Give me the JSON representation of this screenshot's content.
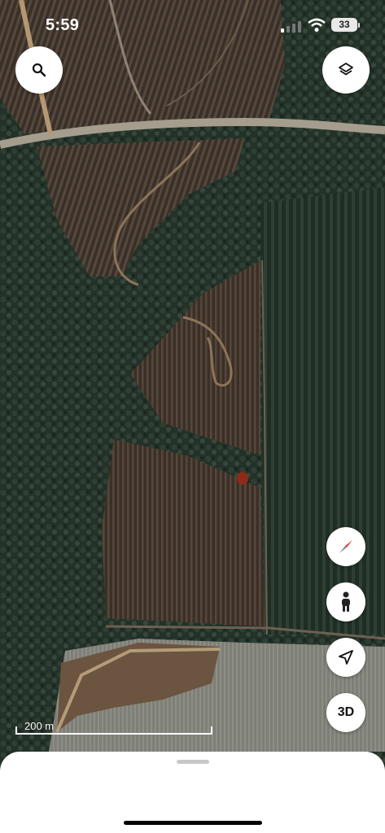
{
  "status_bar": {
    "time": "5:59",
    "battery": "33",
    "signal_icon": "signal-bars-icon",
    "wifi_icon": "wifi-icon"
  },
  "controls": {
    "search_icon": "search-icon",
    "layers_icon": "layers-icon",
    "compass_icon": "compass-icon",
    "street_view_icon": "pegman-icon",
    "location_icon": "location-arrow-icon",
    "three_d_label": "3D"
  },
  "map": {
    "type": "satellite",
    "scale_label": "200 m",
    "colors": {
      "forest": "#26352b",
      "plantation": "#3a2f27",
      "road": "#a49b8a",
      "dirt": "#8a7357",
      "field": "#7f7f74"
    }
  },
  "bottom_sheet": {
    "handle": "drag-handle"
  }
}
